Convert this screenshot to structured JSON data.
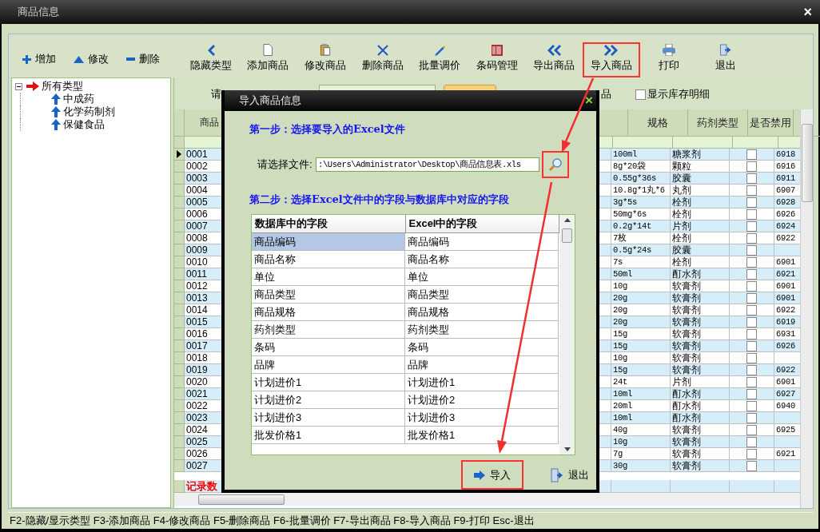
{
  "window": {
    "title": "商品信息",
    "close": "×"
  },
  "side_toolbar": [
    {
      "label": "增加"
    },
    {
      "label": "修改"
    },
    {
      "label": "删除"
    }
  ],
  "toolbar": [
    {
      "label": "隐藏类型",
      "highlighted": false
    },
    {
      "label": "添加商品",
      "highlighted": false
    },
    {
      "label": "修改商品",
      "highlighted": false
    },
    {
      "label": "删除商品",
      "highlighted": false
    },
    {
      "label": "批量调价",
      "highlighted": false
    },
    {
      "label": "条码管理",
      "highlighted": false
    },
    {
      "label": "导出商品",
      "highlighted": false
    },
    {
      "label": "导入商品",
      "highlighted": true
    },
    {
      "label": "打印",
      "highlighted": false
    },
    {
      "label": "退出",
      "highlighted": false
    }
  ],
  "tree": {
    "label": "所有类型",
    "expanded": true,
    "children": [
      {
        "label": "中成药"
      },
      {
        "label": "化学药制剂"
      },
      {
        "label": "保健食品"
      }
    ]
  },
  "filter": {
    "label_1": "请",
    "label_2": "品",
    "stock_detail": {
      "label": "显示库存明细",
      "checked": false
    }
  },
  "table": {
    "columns": [
      "商品",
      "规格",
      "药剂类型",
      "是否禁用"
    ],
    "rows": [
      {
        "code": "0001",
        "spec": "100ml",
        "form": "糖浆剂",
        "disabled": false,
        "barcode": "6918",
        "selected": true
      },
      {
        "code": "0002",
        "spec": "8g*20袋",
        "form": "颗粒",
        "disabled": false,
        "barcode": "6916",
        "selected": false
      },
      {
        "code": "0003",
        "spec": "0.55g*36s",
        "form": "胶囊",
        "disabled": false,
        "barcode": "6911",
        "selected": false
      },
      {
        "code": "0004",
        "spec": "10.8g*1丸*6",
        "form": "丸剂",
        "disabled": false,
        "barcode": "6907",
        "selected": false
      },
      {
        "code": "0005",
        "spec": "3g*5s",
        "form": "栓剂",
        "disabled": false,
        "barcode": "6928",
        "selected": false
      },
      {
        "code": "0006",
        "spec": "50mg*6s",
        "form": "栓剂",
        "disabled": false,
        "barcode": "6926",
        "selected": false
      },
      {
        "code": "0007",
        "spec": "0.2g*14t",
        "form": "片剂",
        "disabled": false,
        "barcode": "6924",
        "selected": false
      },
      {
        "code": "0008",
        "spec": "7枚",
        "form": "栓剂",
        "disabled": false,
        "barcode": "6922",
        "selected": false
      },
      {
        "code": "0009",
        "spec": "0.5g*24s",
        "form": "胶囊",
        "disabled": false,
        "selected": false
      },
      {
        "code": "0010",
        "spec": "7s",
        "form": "栓剂",
        "disabled": false,
        "barcode": "6901",
        "selected": false
      },
      {
        "code": "0011",
        "spec": "50ml",
        "form": "酊水剂",
        "disabled": false,
        "barcode": "6921",
        "selected": false
      },
      {
        "code": "0012",
        "spec": "10g",
        "form": "软膏剂",
        "disabled": false,
        "barcode": "6901",
        "selected": false
      },
      {
        "code": "0013",
        "spec": "20g",
        "form": "软膏剂",
        "disabled": false,
        "barcode": "6901",
        "selected": false
      },
      {
        "code": "0014",
        "spec": "20g",
        "form": "软膏剂",
        "disabled": false,
        "barcode": "6922",
        "selected": false
      },
      {
        "code": "0015",
        "spec": "20g",
        "form": "软膏剂",
        "disabled": false,
        "barcode": "6919",
        "selected": false
      },
      {
        "code": "0016",
        "spec": "15g",
        "form": "软膏剂",
        "disabled": false,
        "barcode": "6931",
        "selected": false
      },
      {
        "code": "0017",
        "spec": "15g",
        "form": "软膏剂",
        "disabled": false,
        "barcode": "6926",
        "selected": false
      },
      {
        "code": "0018",
        "spec": "10g",
        "form": "软膏剂",
        "disabled": false,
        "selected": false
      },
      {
        "code": "0019",
        "spec": "15g",
        "form": "软膏剂",
        "disabled": false,
        "barcode": "6922",
        "selected": false
      },
      {
        "code": "0020",
        "spec": "24t",
        "form": "片剂",
        "disabled": false,
        "barcode": "6901",
        "selected": false
      },
      {
        "code": "0021",
        "spec": "10ml",
        "form": "酊水剂",
        "disabled": false,
        "barcode": "6927",
        "selected": false
      },
      {
        "code": "0022",
        "spec": "20ml",
        "form": "酊水剂",
        "disabled": false,
        "barcode": "6940",
        "selected": false
      },
      {
        "code": "0023",
        "spec": "10ml",
        "form": "酊水剂",
        "disabled": false,
        "selected": false
      },
      {
        "code": "0024",
        "spec": "40g",
        "form": "软膏剂",
        "disabled": false,
        "barcode": "6925",
        "selected": false
      },
      {
        "code": "0025",
        "spec": "10g",
        "form": "软膏剂",
        "disabled": false,
        "selected": false
      },
      {
        "code": "0026",
        "spec": "7g",
        "form": "软膏剂",
        "disabled": false,
        "barcode": "6921",
        "selected": false
      },
      {
        "code": "0027",
        "spec": "30g",
        "form": "软膏剂",
        "disabled": false,
        "selected": false
      }
    ],
    "footer": "记录数"
  },
  "dialog": {
    "title": "导入商品信息",
    "close": "×",
    "step_1": "第一步：选择要导入的Excel文件",
    "file_label": "请选择文件:",
    "file_value": ":\\Users\\Administrator\\Desktop\\商品信息表.xls",
    "browse_highlighted": true,
    "step_2": "第二步：选择Excel文件中的字段与数据库中对应的字段",
    "columns": [
      "数据库中的字段",
      "Excel中的字段"
    ],
    "mappings": [
      {
        "db": "商品编码",
        "excel": "商品编码",
        "selected": true
      },
      {
        "db": "商品名称",
        "excel": "商品名称",
        "selected": false
      },
      {
        "db": "单位",
        "excel": "单位",
        "selected": false
      },
      {
        "db": "商品类型",
        "excel": "商品类型",
        "selected": false
      },
      {
        "db": "商品规格",
        "excel": "商品规格",
        "selected": false
      },
      {
        "db": "药剂类型",
        "excel": "药剂类型",
        "selected": false
      },
      {
        "db": "条码",
        "excel": "条码",
        "selected": false
      },
      {
        "db": "品牌",
        "excel": "品牌",
        "selected": false
      },
      {
        "db": "计划进价1",
        "excel": "计划进价1",
        "selected": false
      },
      {
        "db": "计划进价2",
        "excel": "计划进价2",
        "selected": false
      },
      {
        "db": "计划进价3",
        "excel": "计划进价3",
        "selected": false
      },
      {
        "db": "批发价格1",
        "excel": "批发价格1",
        "selected": false
      }
    ],
    "buttons": [
      {
        "label": "导入",
        "highlighted": true
      },
      {
        "label": "退出",
        "highlighted": false
      }
    ]
  },
  "status_bar": "F2-隐藏/显示类型  F3-添加商品 F4-修改商品 F5-删除商品 F6-批量调价 F7-导出商品 F8-导入商品 F9-打印 Esc-退出"
}
